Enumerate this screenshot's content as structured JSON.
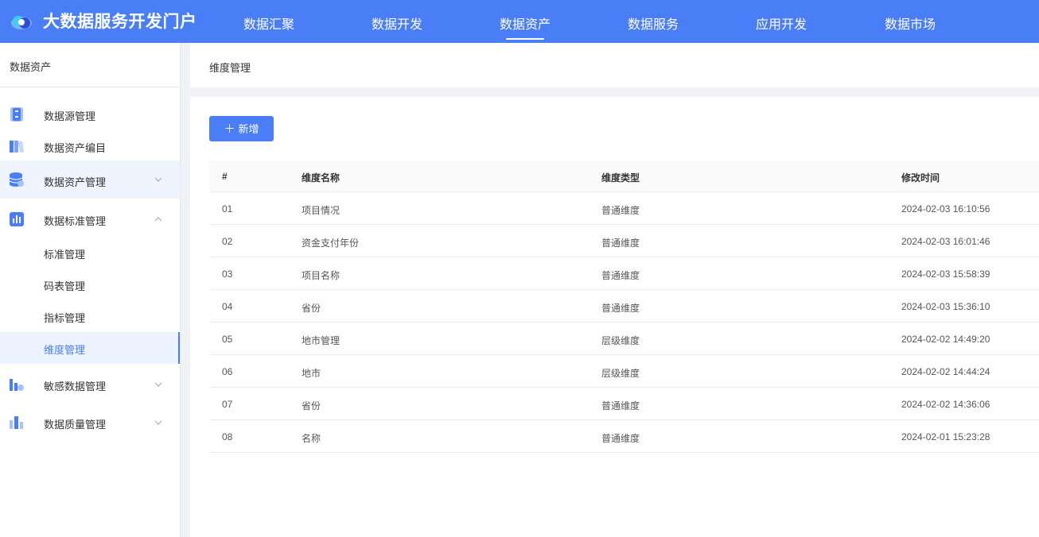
{
  "header": {
    "title": "大数据服务开发门户",
    "nav": [
      {
        "label": "数据汇聚",
        "active": false
      },
      {
        "label": "数据开发",
        "active": false
      },
      {
        "label": "数据资产",
        "active": true
      },
      {
        "label": "数据服务",
        "active": false
      },
      {
        "label": "应用开发",
        "active": false
      },
      {
        "label": "数据市场",
        "active": false
      }
    ]
  },
  "sidebar": {
    "title": "数据资产",
    "items": [
      {
        "label": "数据源管理",
        "icon": "database-source-icon"
      },
      {
        "label": "数据资产编目",
        "icon": "catalog-books-icon"
      },
      {
        "label": "数据资产管理",
        "icon": "database-stack-icon",
        "expanded": false
      },
      {
        "label": "数据标准管理",
        "icon": "bar-chart-icon",
        "expanded": true
      },
      {
        "label": "标准管理"
      },
      {
        "label": "码表管理"
      },
      {
        "label": "指标管理"
      },
      {
        "label": "维度管理",
        "active": true
      },
      {
        "label": "敏感数据管理",
        "icon": "sensitive-data-icon",
        "expanded": false
      },
      {
        "label": "数据质量管理",
        "icon": "quality-chart-icon",
        "expanded": false
      }
    ]
  },
  "breadcrumb": "维度管理",
  "toolbar": {
    "add_label": "新增"
  },
  "table": {
    "columns": [
      "#",
      "维度名称",
      "维度类型",
      "修改时间"
    ],
    "rows": [
      [
        "01",
        "项目情况",
        "普通维度",
        "2024-02-03 16:10:56"
      ],
      [
        "02",
        "资金支付年份",
        "普通维度",
        "2024-02-03 16:01:46"
      ],
      [
        "03",
        "项目名称",
        "普通维度",
        "2024-02-03 15:58:39"
      ],
      [
        "04",
        "省份",
        "普通维度",
        "2024-02-03 15:36:10"
      ],
      [
        "05",
        "地市管理",
        "层级维度",
        "2024-02-02 14:49:20"
      ],
      [
        "06",
        "地市",
        "层级维度",
        "2024-02-02 14:44:24"
      ],
      [
        "07",
        "省份",
        "普通维度",
        "2024-02-02 14:36:06"
      ],
      [
        "08",
        "名称",
        "普通维度",
        "2024-02-01 15:23:28"
      ]
    ]
  },
  "colors": {
    "primary": "#4a7ef7",
    "active_bg": "#edf2ff"
  }
}
